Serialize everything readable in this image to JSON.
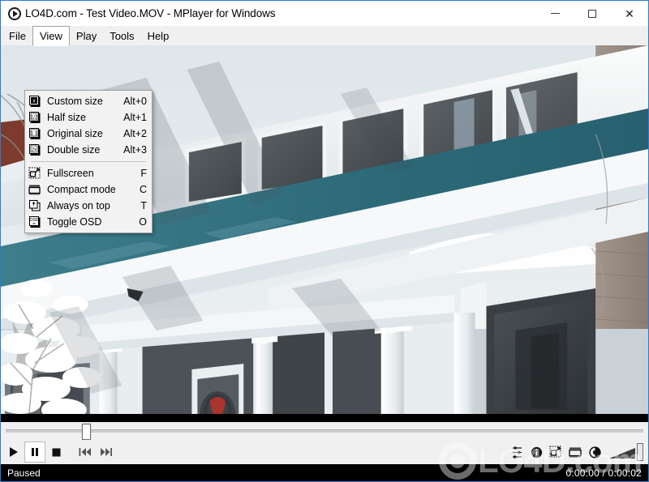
{
  "window": {
    "title": "LO4D.com - Test Video.MOV - MPlayer for Windows",
    "app_icon": "play-circle-icon",
    "buttons": {
      "minimize": "minimize-icon",
      "maximize": "maximize-icon",
      "close": "close-icon"
    },
    "border_color": "#2b7cd3"
  },
  "menubar": {
    "items": [
      {
        "label": "File",
        "active": false
      },
      {
        "label": "View",
        "active": true
      },
      {
        "label": "Play",
        "active": false
      },
      {
        "label": "Tools",
        "active": false
      },
      {
        "label": "Help",
        "active": false
      }
    ]
  },
  "view_menu": {
    "groups": [
      {
        "items": [
          {
            "label": "Custom size",
            "shortcut": "Alt+0",
            "icon": "custom-size-icon"
          },
          {
            "label": "Half size",
            "shortcut": "Alt+1",
            "icon": "half-size-icon"
          },
          {
            "label": "Original size",
            "shortcut": "Alt+2",
            "icon": "original-size-icon"
          },
          {
            "label": "Double size",
            "shortcut": "Alt+3",
            "icon": "double-size-icon"
          }
        ]
      },
      {
        "items": [
          {
            "label": "Fullscreen",
            "shortcut": "F",
            "icon": "fullscreen-icon"
          },
          {
            "label": "Compact mode",
            "shortcut": "C",
            "icon": "compact-mode-icon"
          },
          {
            "label": "Always on top",
            "shortcut": "T",
            "icon": "always-on-top-icon"
          },
          {
            "label": "Toggle OSD",
            "shortcut": "O",
            "icon": "toggle-osd-icon"
          }
        ]
      }
    ]
  },
  "video": {
    "description": "Winter street scene: white clapboard house corner with teal trim band, snow-covered tree at left, bay windows, porch columns and a wreath on the front door",
    "background_color": "#000000",
    "palette": {
      "sky_white": "#e8edf0",
      "siding_white": "#f4f6f7",
      "teal_trim": "#2e6f7e",
      "dark_glass": "#3c4044",
      "brick": "#9a8d84",
      "red_roof": "#7d3b2e",
      "wreath_red": "#c0392b"
    }
  },
  "seekbar": {
    "name": "seek-slider",
    "position_percent": 12,
    "min": 0,
    "max": 100
  },
  "transport": {
    "buttons": [
      {
        "name": "play-button",
        "icon": "play-icon",
        "pressed": false
      },
      {
        "name": "pause-button",
        "icon": "pause-icon",
        "pressed": true
      },
      {
        "name": "stop-button",
        "icon": "stop-icon",
        "pressed": false
      },
      {
        "name": "previous-button",
        "icon": "previous-icon",
        "pressed": false
      },
      {
        "name": "next-button",
        "icon": "next-icon",
        "pressed": false
      }
    ]
  },
  "right_controls": {
    "buttons": [
      {
        "name": "equalizer-button",
        "icon": "equalizer-icon"
      },
      {
        "name": "info-button",
        "icon": "info-icon"
      },
      {
        "name": "fullscreen-button",
        "icon": "fullscreen-icon"
      },
      {
        "name": "compact-button",
        "icon": "compact-mode-icon"
      },
      {
        "name": "balance-button",
        "icon": "contrast-icon"
      }
    ],
    "volume": {
      "name": "volume-slider",
      "level_percent": 100
    }
  },
  "statusbar": {
    "status": "Paused",
    "time": "0:00:00 / 0:00:02"
  },
  "watermark": {
    "text": "LO4D.com"
  }
}
